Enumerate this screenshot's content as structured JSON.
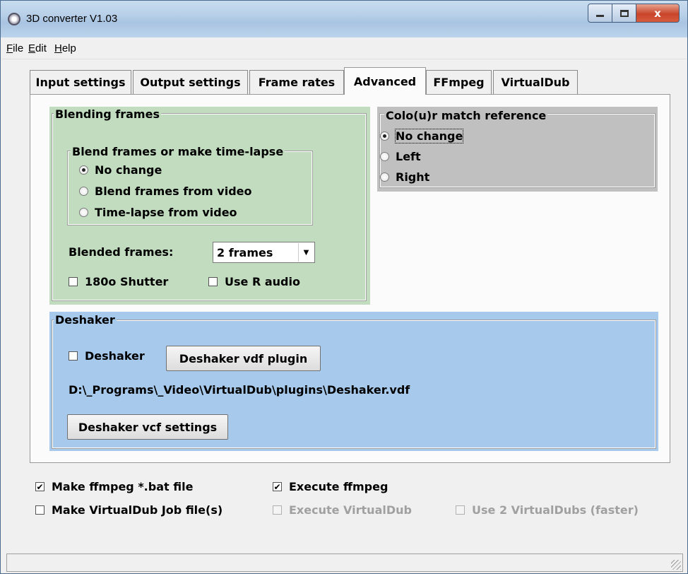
{
  "window": {
    "title": "3D converter V1.03",
    "close_glyph": "x"
  },
  "menu": [
    {
      "label": "File"
    },
    {
      "label": "Edit"
    },
    {
      "label": "Help"
    }
  ],
  "tabs": [
    {
      "label": "Input settings"
    },
    {
      "label": "Output settings"
    },
    {
      "label": "Frame rates"
    },
    {
      "label": "Advanced",
      "active": true
    },
    {
      "label": "FFmpeg"
    },
    {
      "label": "VirtualDub"
    }
  ],
  "blending": {
    "title": "Blending frames",
    "sub_title": "Blend frames or make time-lapse",
    "options": [
      {
        "label": "No change",
        "selected": true
      },
      {
        "label": "Blend frames from video",
        "selected": false
      },
      {
        "label": "Time-lapse from video",
        "selected": false
      }
    ],
    "blended_frames_label": "Blended frames:",
    "blended_frames_value": "2 frames",
    "shutter_label": "180o Shutter",
    "shutter_checked": false,
    "r_audio_label": "Use R audio",
    "r_audio_checked": false,
    "color": "#c1dcbf"
  },
  "colour_match": {
    "title": "Colo(u)r match reference",
    "options": [
      {
        "label": "No change",
        "selected": true
      },
      {
        "label": "Left",
        "selected": false
      },
      {
        "label": "Right",
        "selected": false
      }
    ],
    "color": "#c0c0c0"
  },
  "deshaker": {
    "title": "Deshaker",
    "checkbox_label": "Deshaker",
    "checked": false,
    "plugin_button": "Deshaker vdf plugin",
    "path": "D:\\_Programs\\_Video\\VirtualDub\\plugins\\Deshaker.vdf",
    "settings_button": "Deshaker vcf settings",
    "color": "#a6c9ec"
  },
  "footer": {
    "make_bat": {
      "label": "Make ffmpeg *.bat file",
      "checked": true
    },
    "execute_ffmpeg": {
      "label": "Execute ffmpeg",
      "checked": true
    },
    "make_vdub_job": {
      "label": "Make VirtualDub Job file(s)",
      "checked": false
    },
    "execute_vdub": {
      "label": "Execute VirtualDub",
      "checked": false,
      "disabled": true
    },
    "two_vdubs": {
      "label": "Use 2 VirtualDubs (faster)",
      "checked": false,
      "disabled": true
    }
  }
}
